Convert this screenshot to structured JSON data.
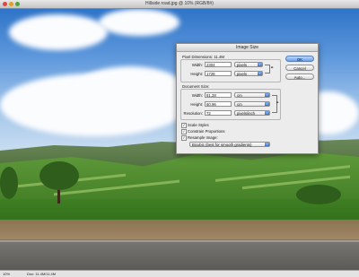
{
  "window": {
    "title": "Hillside road.jpg @ 10% (RGB/8#)"
  },
  "status": {
    "zoom": "10%",
    "doc_info": "Doc: 11.4M/11.4M"
  },
  "dialog": {
    "title": "Image Size",
    "pixel_dimensions": {
      "label": "Pixel Dimensions:  11.4M",
      "width_label": "Width:",
      "width_value": "2304",
      "width_unit": "pixels",
      "height_label": "Height:",
      "height_value": "1728",
      "height_unit": "pixels"
    },
    "document_size": {
      "label": "Document Size:",
      "width_label": "Width:",
      "width_value": "81.28",
      "width_unit": "cm",
      "height_label": "Height:",
      "height_value": "60.96",
      "height_unit": "cm",
      "resolution_label": "Resolution:",
      "resolution_value": "72",
      "resolution_unit": "pixels/inch"
    },
    "options": {
      "scale_styles": "Scale Styles",
      "constrain": "Constrain Proportions",
      "resample": "Resample Image:",
      "resample_method": "Bicubic (best for smooth gradients)"
    },
    "buttons": {
      "ok": "OK",
      "cancel": "Cancel",
      "auto": "Auto..."
    }
  }
}
